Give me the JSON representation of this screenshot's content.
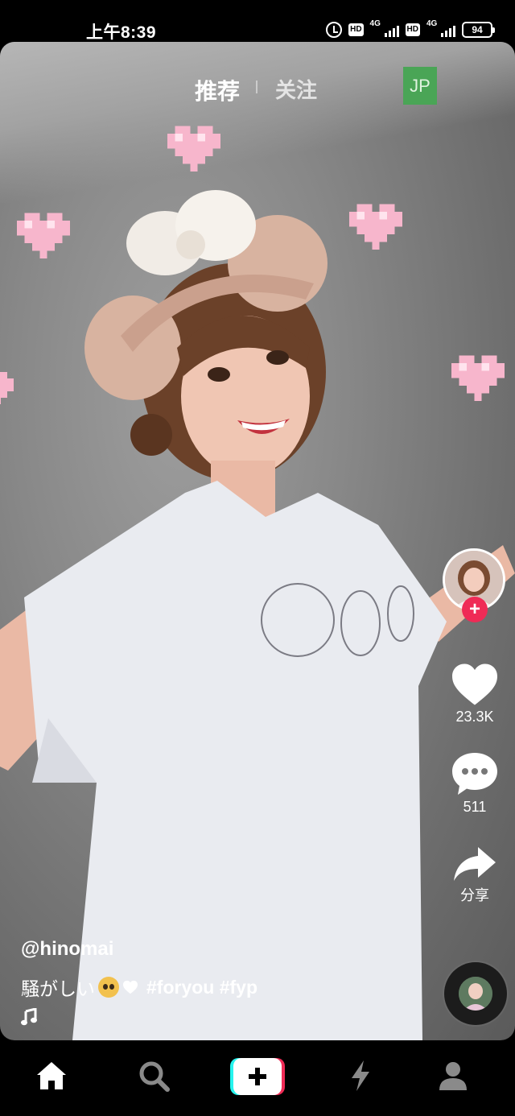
{
  "status_bar": {
    "time": "上午8:39",
    "network_1": "4G",
    "network_2": "4G",
    "hd_1": "HD",
    "hd_2": "HD",
    "battery": "94",
    "icons": [
      "alarm-icon",
      "hd-icon",
      "signal-icon",
      "hd-icon",
      "signal-icon",
      "battery-icon"
    ]
  },
  "header": {
    "tab_active": "推荐",
    "tab_inactive": "关注",
    "region_badge": "JP"
  },
  "sidebar": {
    "follow_label": "+",
    "likes": "23.3K",
    "comments": "511",
    "share_label": "分享",
    "icons": [
      "avatar",
      "heart-icon",
      "comment-icon",
      "share-icon",
      "music-disc-icon"
    ]
  },
  "video": {
    "username": "@hinomai",
    "caption_text": "騒がしい",
    "hashtags": "#foryou #fyp",
    "music_icon": "music-note-icon"
  },
  "bottom_nav": {
    "items": [
      "home-icon",
      "search-icon",
      "create-icon",
      "inbox-bolt-icon",
      "profile-icon"
    ]
  },
  "colors": {
    "accent_red": "#ef2b56",
    "accent_cyan": "#25f4ee",
    "badge_green": "#4aa556"
  }
}
